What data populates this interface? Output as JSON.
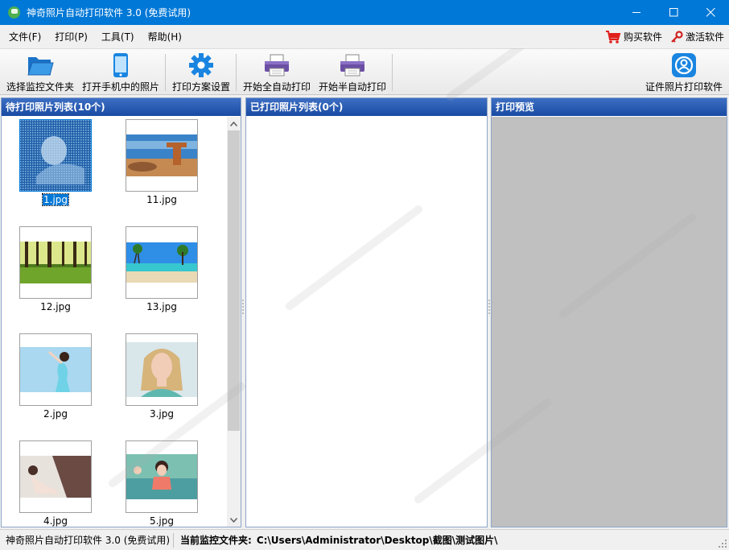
{
  "window": {
    "title": "神奇照片自动打印软件 3.0 (免费试用)",
    "controls": [
      "minimize-icon",
      "maximize-icon",
      "close-icon"
    ]
  },
  "menu": {
    "items": [
      "文件(F)",
      "打印(P)",
      "工具(T)",
      "帮助(H)"
    ],
    "buy": "购买软件",
    "activate": "激活软件"
  },
  "toolbar": {
    "select_folder": "选择监控文件夹",
    "open_phone": "打开手机中的照片",
    "print_settings": "打印方案设置",
    "auto_print": "开始全自动打印",
    "semi_auto_print": "开始半自动打印",
    "id_photo": "证件照片打印软件"
  },
  "panels": {
    "pending": {
      "title": "待打印照片列表(10个)"
    },
    "printed": {
      "title": "已打印照片列表(0个)"
    },
    "preview": {
      "title": "打印预览"
    }
  },
  "photos": [
    {
      "name": "1.jpg",
      "selected": true
    },
    {
      "name": "11.jpg"
    },
    {
      "name": "12.jpg"
    },
    {
      "name": "13.jpg"
    },
    {
      "name": "2.jpg"
    },
    {
      "name": "3.jpg"
    },
    {
      "name": "4.jpg"
    },
    {
      "name": "5.jpg"
    }
  ],
  "status": {
    "app": "神奇照片自动打印软件 3.0 (免费试用)",
    "folder_label": "当前监控文件夹:",
    "folder_path": "C:\\Users\\Administrator\\Desktop\\截图\\测试图片\\"
  },
  "colors": {
    "titlebar": "#0078d7",
    "panel_header": "#1a4ba3",
    "preview_bg": "#c0c0c0"
  }
}
